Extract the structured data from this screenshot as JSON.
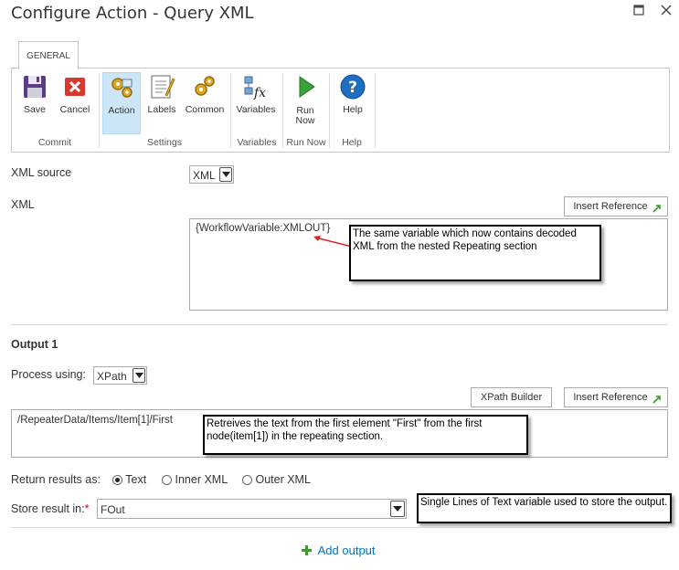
{
  "window": {
    "title": "Configure Action - Query XML"
  },
  "tab": {
    "label": "GENERAL"
  },
  "ribbon": {
    "buttons": {
      "save": "Save",
      "cancel": "Cancel",
      "action": "Action",
      "labels": "Labels",
      "common": "Common",
      "variables": "Variables",
      "run_now_1": "Run",
      "run_now_2": "Now",
      "help": "Help"
    },
    "groups": {
      "commit": "Commit",
      "settings": "Settings",
      "variables": "Variables",
      "run_now": "Run Now",
      "help": "Help"
    }
  },
  "form": {
    "xml_source_label": "XML source",
    "xml_source_value": "XML",
    "xml_label": "XML",
    "insert_reference": "Insert Reference",
    "xml_value": "{WorkflowVariable:XMLOUT}",
    "output_heading": "Output 1",
    "process_using_label": "Process using:",
    "process_using_value": "XPath",
    "xpath_builder": "XPath Builder",
    "insert_reference_2": "Insert Reference",
    "xpath_value": "/RepeaterData/Items/Item[1]/First",
    "return_results_label": "Return results as:",
    "return_options": [
      "Text",
      "Inner XML",
      "Outer XML"
    ],
    "store_result_label": "Store result in:",
    "required_mark": "*",
    "store_result_value": "FOut",
    "add_output": "Add output"
  },
  "callouts": {
    "c1": "The same variable which now contains decoded XML from the nested Repeating section",
    "c2": "Retreives the text from the first element \"First\" from the first node(item[1]) in the repeating section.",
    "c3": "Single Lines of Text variable used to store the output."
  },
  "colors": {
    "accent_blue": "#0072c6",
    "selected_bg": "#cde6f7",
    "arrow_red": "#e02020",
    "plus_green": "#3c9a26"
  }
}
